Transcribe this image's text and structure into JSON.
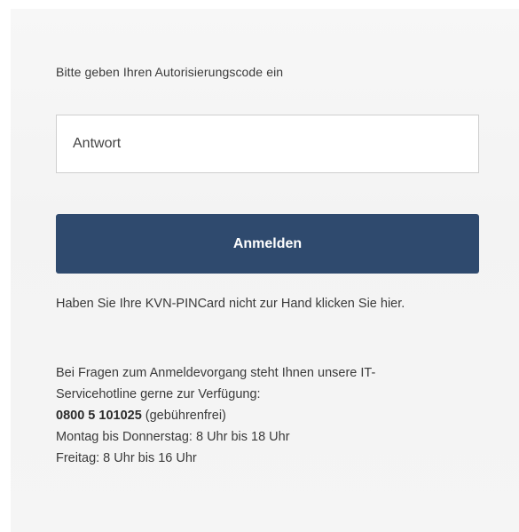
{
  "login": {
    "prompt": "Bitte geben Ihren Autorisierungscode ein",
    "answer_placeholder": "Antwort",
    "answer_value": "",
    "submit_label": "Anmelden"
  },
  "pincard": {
    "text": "Haben Sie Ihre KVN-PINCard nicht zur Hand klicken Sie",
    "link_label": "hier."
  },
  "help": {
    "line1": "Bei Fragen zum Anmeldevorgang steht Ihnen unsere IT-",
    "line2": "Servicehotline gerne zur Verfügung:",
    "phone": "0800 5 101025",
    "phone_note": " (gebührenfrei)",
    "hours_weekdays": "Montag bis Donnerstag: 8 Uhr bis 18 Uhr",
    "hours_friday": "Freitag: 8 Uhr bis 16 Uhr"
  },
  "colors": {
    "button_background": "#2f4a6e",
    "panel_background": "#f5f5f5"
  }
}
